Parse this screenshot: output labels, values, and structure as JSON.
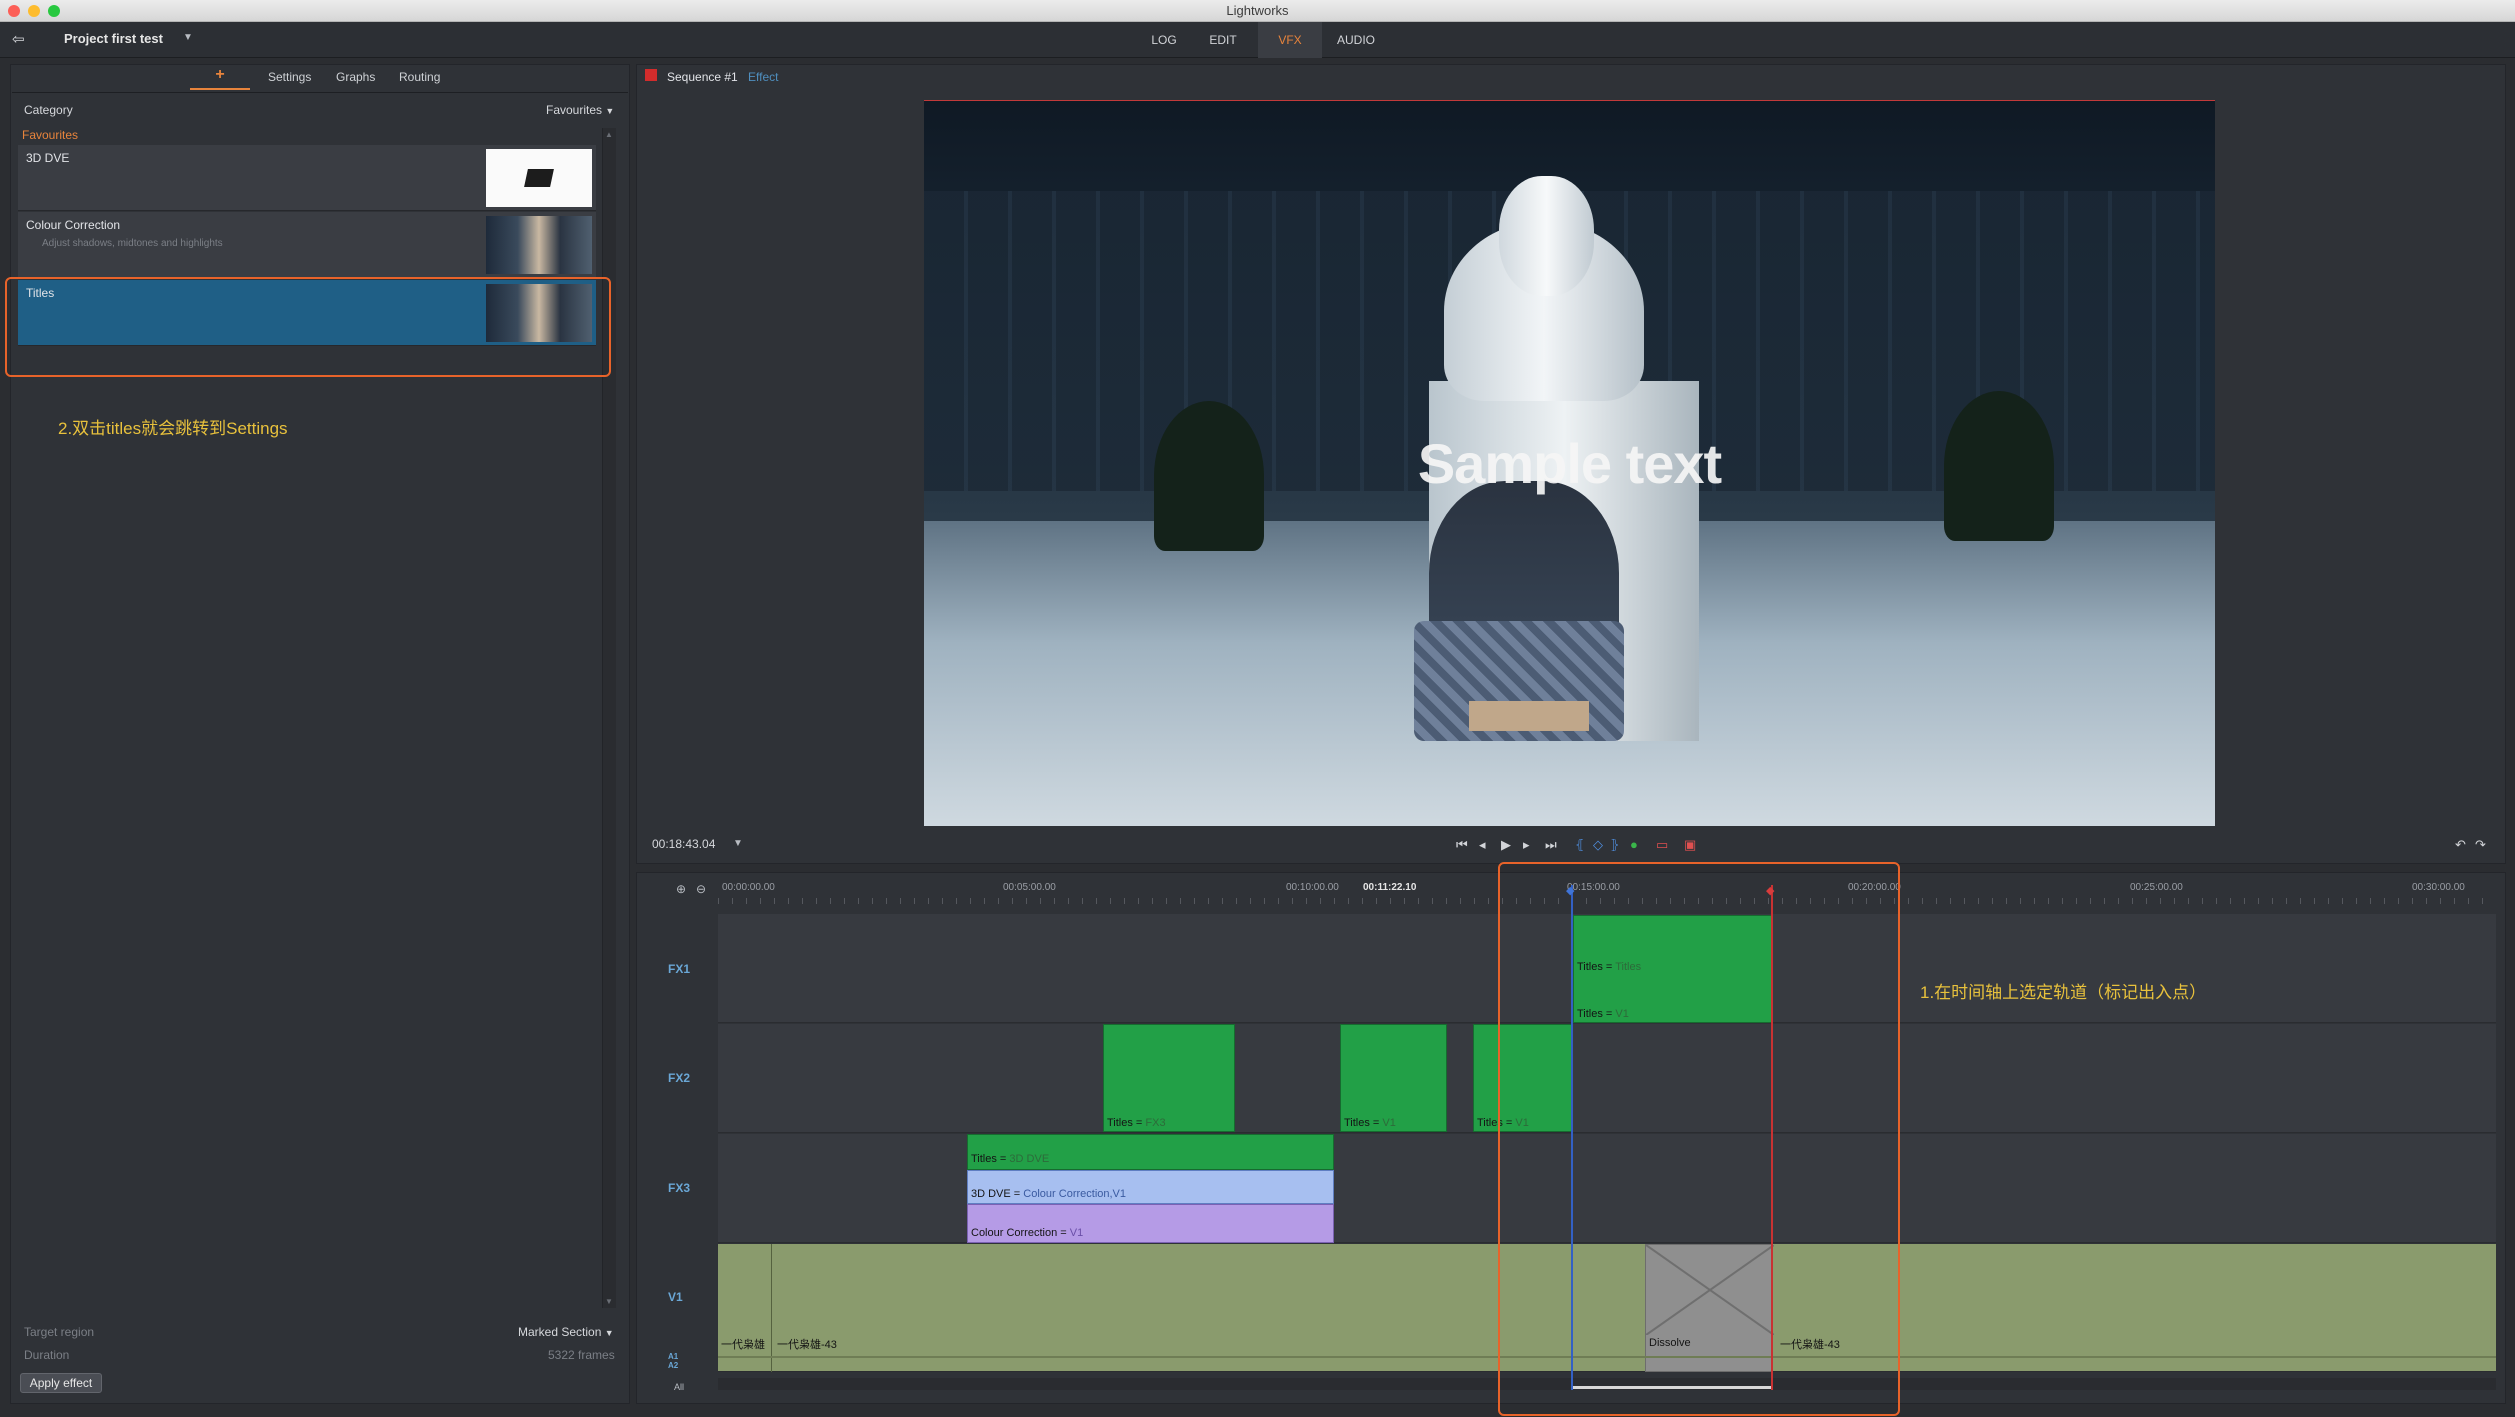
{
  "window": {
    "title": "Lightworks"
  },
  "app": {
    "project_name": "Project first test",
    "workspace_tabs": [
      "LOG",
      "EDIT",
      "VFX",
      "AUDIO"
    ],
    "active_tab": "VFX",
    "accent_color": "#e8843c"
  },
  "effects_panel": {
    "tabs": {
      "add": "+",
      "settings": "Settings",
      "graphs": "Graphs",
      "routing": "Routing"
    },
    "category_label": "Category",
    "category_value": "Favourites",
    "section_header": "Favourites",
    "items": [
      {
        "name": "3D DVE",
        "description": ""
      },
      {
        "name": "Colour Correction",
        "description": "Adjust shadows, midtones and highlights"
      },
      {
        "name": "Titles",
        "description": ""
      }
    ],
    "selected_item": "Titles",
    "annotation": "2.双击titles就会跳转到Settings",
    "target_region_label": "Target region",
    "target_region_value": "Marked Section",
    "duration_label": "Duration",
    "duration_value": "5322 frames",
    "apply_button": "Apply effect"
  },
  "viewer": {
    "sequence_name": "Sequence #1",
    "sequence_effect": "Effect",
    "overlay_text": "Sample text",
    "timecode": "00:18:43.04"
  },
  "timeline": {
    "ruler_ticks": [
      "00:00:00.00",
      "00:05:00.00",
      "00:10:00.00",
      "00:11:22.10",
      "00:15:00.00",
      "00:20:00.00",
      "00:25:00.00",
      "00:30:00.00"
    ],
    "current_time": "00:11:22.10",
    "tracks": [
      "FX1",
      "FX2",
      "FX3",
      "V1",
      "A1 A2",
      "All"
    ],
    "fx1_clips": [
      {
        "title": "Titles",
        "source": "Titles"
      },
      {
        "title": "Titles",
        "source": "V1"
      }
    ],
    "fx2_clips": [
      {
        "title": "Titles",
        "source": "FX3"
      },
      {
        "title": "Titles",
        "source": "V1"
      },
      {
        "title": "Titles",
        "source": "V1"
      }
    ],
    "fx3_clips": [
      {
        "title": "Titles",
        "source": "3D DVE"
      },
      {
        "title": "3D DVE",
        "source": "Colour Correction,V1"
      },
      {
        "title": "Colour Correction",
        "source": "V1"
      }
    ],
    "v1_clips": [
      "一代枭雄",
      "一代枭雄-43",
      "Dissolve",
      "一代枭雄-43"
    ],
    "annotation": "1.在时间轴上选定轨道（标记出入点）"
  }
}
